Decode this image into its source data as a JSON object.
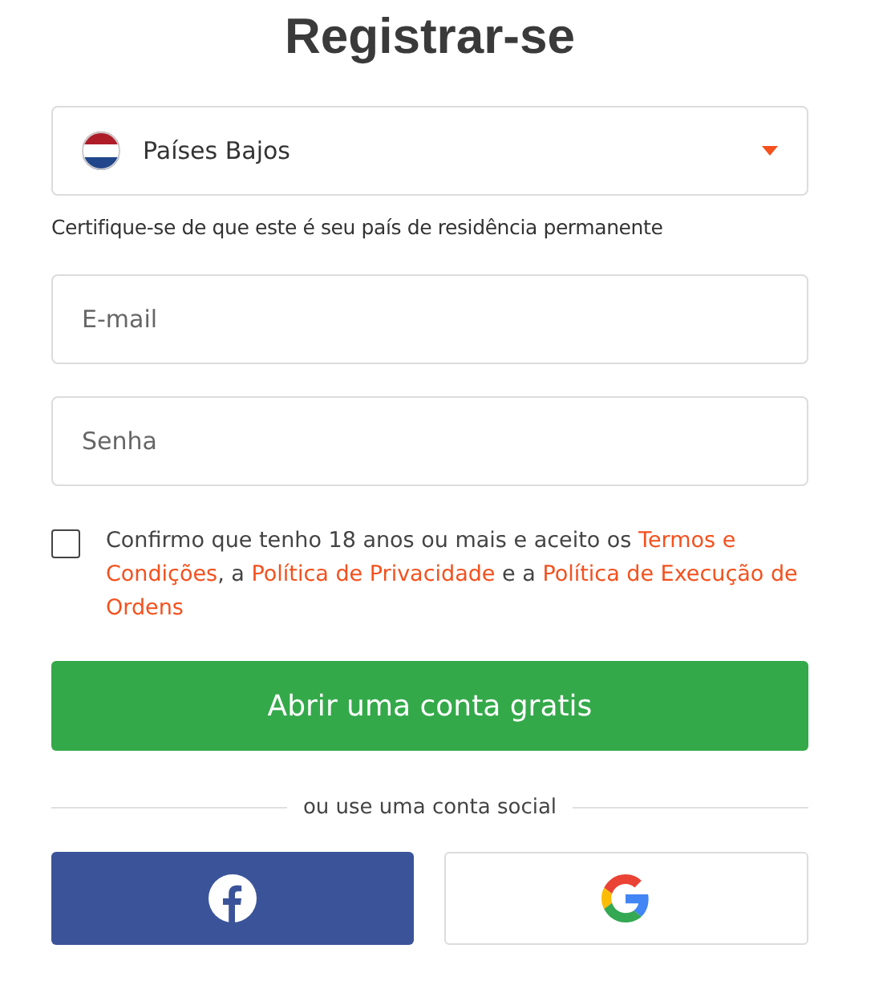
{
  "title": "Registrar-se",
  "country": {
    "value": "Países Bajos",
    "hint": "Certifique-se de que este é seu país de residência permanente"
  },
  "fields": [
    {
      "placeholder": "E-mail"
    },
    {
      "placeholder": "Senha"
    }
  ],
  "consent": {
    "checked": false,
    "parts": [
      {
        "kind": "text",
        "text": "Confirmo que tenho 18 anos ou mais e aceito os "
      },
      {
        "kind": "link",
        "text": "Termos e Condições"
      },
      {
        "kind": "text",
        "text": ", a "
      },
      {
        "kind": "link",
        "text": "Política de Privacidade"
      },
      {
        "kind": "text",
        "text": " e a "
      },
      {
        "kind": "link",
        "text": "Política de Execução de Ordens"
      }
    ]
  },
  "submit": "Abrir uma conta gratis",
  "divider": "ou use uma conta social",
  "social": [
    {
      "kind": "facebook"
    },
    {
      "kind": "google"
    }
  ]
}
